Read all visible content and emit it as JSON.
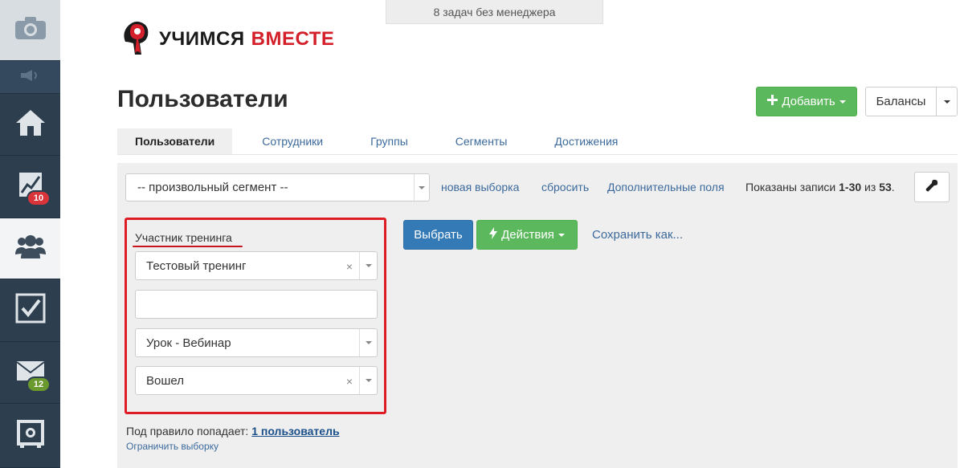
{
  "banner": {
    "text": "8 задач без менеджера"
  },
  "logo": {
    "dark_part": "УЧИМСЯ",
    "red_part": "ВМЕСТЕ"
  },
  "page": {
    "title": "Пользователи"
  },
  "header_buttons": {
    "add_label": "Добавить",
    "balances_label": "Балансы"
  },
  "tabs": [
    {
      "label": "Пользователи",
      "active": true
    },
    {
      "label": "Сотрудники",
      "active": false
    },
    {
      "label": "Группы",
      "active": false
    },
    {
      "label": "Сегменты",
      "active": false
    },
    {
      "label": "Достижения",
      "active": false
    }
  ],
  "sidebar": {
    "icons": [
      "camera-icon",
      "speaker-icon",
      "home-icon",
      "chart-icon",
      "users-icon",
      "checkbox-icon",
      "mail-icon",
      "safe-icon"
    ],
    "chart_badge": "10",
    "mail_badge": "12"
  },
  "filter": {
    "segment_value": "-- произвольный сегмент --",
    "new_selection": "новая выборка",
    "reset": "сбросить",
    "extra_fields": "Дополнительные поля",
    "records_prefix": "Показаны записи",
    "records_range": "1-30",
    "records_of": "из",
    "records_total": "53",
    "records_suffix": "."
  },
  "rule": {
    "title": "Участник тренинга",
    "training_value": "Тестовый тренинг",
    "text_value": "",
    "lesson_value": "Урок - Вебинар",
    "status_value": "Вошел",
    "clear_symbol": "×"
  },
  "actions": {
    "select_label": "Выбрать",
    "actions_label": "Действия",
    "save_as_label": "Сохранить как..."
  },
  "result": {
    "prefix": "Под правило попадает:",
    "count_link": "1 пользователь",
    "limit_link": "Ограничить выборку"
  },
  "colors": {
    "sidebar_bg": "#2d3e4f",
    "green": "#5cb85c",
    "blue": "#337ab7",
    "link": "#3c6a9c",
    "highlight_red": "#dd1c25"
  }
}
